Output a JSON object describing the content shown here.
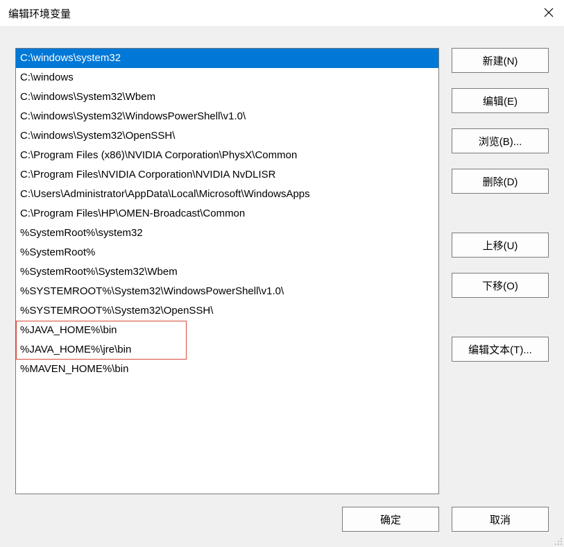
{
  "title": "编辑环境变量",
  "list": {
    "selectedIndex": 0,
    "items": [
      "C:\\windows\\system32",
      "C:\\windows",
      "C:\\windows\\System32\\Wbem",
      "C:\\windows\\System32\\WindowsPowerShell\\v1.0\\",
      "C:\\windows\\System32\\OpenSSH\\",
      "C:\\Program Files (x86)\\NVIDIA Corporation\\PhysX\\Common",
      "C:\\Program Files\\NVIDIA Corporation\\NVIDIA NvDLISR",
      "C:\\Users\\Administrator\\AppData\\Local\\Microsoft\\WindowsApps",
      "C:\\Program Files\\HP\\OMEN-Broadcast\\Common",
      "%SystemRoot%\\system32",
      "%SystemRoot%",
      "%SystemRoot%\\System32\\Wbem",
      "%SYSTEMROOT%\\System32\\WindowsPowerShell\\v1.0\\",
      "%SYSTEMROOT%\\System32\\OpenSSH\\",
      "%JAVA_HOME%\\bin",
      "%JAVA_HOME%\\jre\\bin",
      "%MAVEN_HOME%\\bin"
    ],
    "highlightRange": {
      "start": 14,
      "end": 15
    }
  },
  "buttons": {
    "new": "新建(N)",
    "edit": "编辑(E)",
    "browse": "浏览(B)...",
    "delete": "删除(D)",
    "moveUp": "上移(U)",
    "moveDown": "下移(O)",
    "editText": "编辑文本(T)..."
  },
  "footer": {
    "ok": "确定",
    "cancel": "取消"
  }
}
